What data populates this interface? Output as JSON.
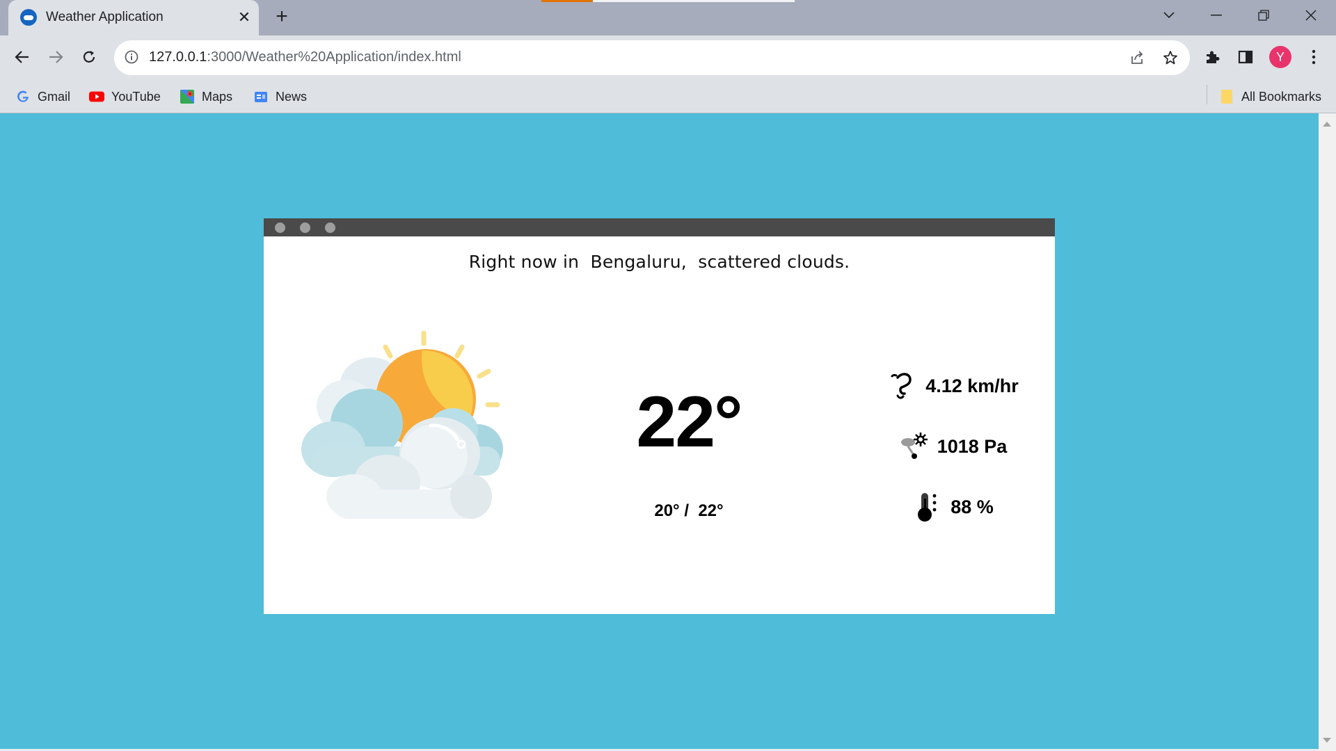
{
  "browser": {
    "tab_title": "Weather Application",
    "url_host": "127.0.0.1",
    "url_path": ":3000/Weather%20Application/index.html",
    "bookmarks": [
      {
        "label": "Gmail",
        "icon": "google-icon"
      },
      {
        "label": "YouTube",
        "icon": "youtube-icon"
      },
      {
        "label": "Maps",
        "icon": "maps-icon"
      },
      {
        "label": "News",
        "icon": "news-icon"
      }
    ],
    "all_bookmarks_label": "All Bookmarks",
    "avatar_letter": "Y"
  },
  "weather": {
    "prefix": "Right now in ",
    "city": "Bengaluru,",
    "condition": "scattered clouds.",
    "temperature": "22°",
    "min_max": "20° /  22°",
    "wind": "4.12 km/hr",
    "pressure": "1018 Pa",
    "humidity": "88 %",
    "icon": "sun-behind-clouds-icon"
  },
  "colors": {
    "page_background": "#4fbcd9",
    "card_bar": "#4a4a4a",
    "sun": "#f7b733",
    "avatar": "#e8336b"
  }
}
